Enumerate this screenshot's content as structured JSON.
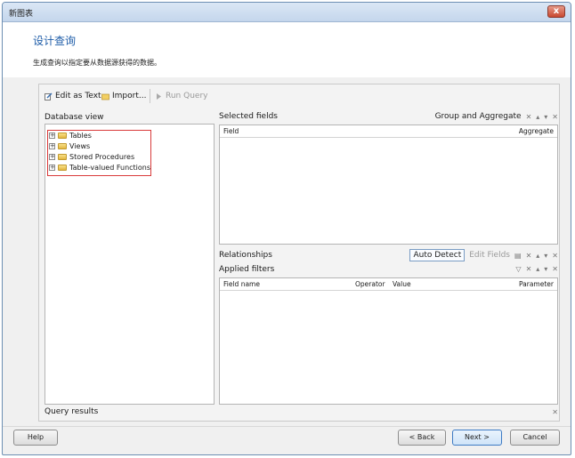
{
  "window": {
    "title": "新图表",
    "close_glyph": "x"
  },
  "header": {
    "heading": "设计查询",
    "description": "生成查询以指定要从数据源获得的数据。"
  },
  "toolbar": {
    "edit_as_text": "Edit as Text",
    "import": "Import...",
    "run_query": "Run Query"
  },
  "database_view": {
    "label": "Database view",
    "items": [
      {
        "label": "Tables",
        "icon": "folder-icon"
      },
      {
        "label": "Views",
        "icon": "folder-icon"
      },
      {
        "label": "Stored Procedures",
        "icon": "folder-icon"
      },
      {
        "label": "Table-valued Functions",
        "icon": "folder-icon"
      }
    ]
  },
  "selected_fields": {
    "label": "Selected fields",
    "group_and_aggregate": "Group and Aggregate",
    "columns": [
      "Field",
      "Aggregate"
    ]
  },
  "relationships": {
    "label": "Relationships",
    "auto_detect": "Auto Detect",
    "edit_fields": "Edit Fields"
  },
  "applied_filters": {
    "label": "Applied filters",
    "columns": [
      "Field name",
      "Operator",
      "Value",
      "Parameter"
    ]
  },
  "query_results": {
    "label": "Query results"
  },
  "buttons": {
    "help": "Help",
    "back": "< Back",
    "next": "Next >",
    "cancel": "Cancel"
  }
}
